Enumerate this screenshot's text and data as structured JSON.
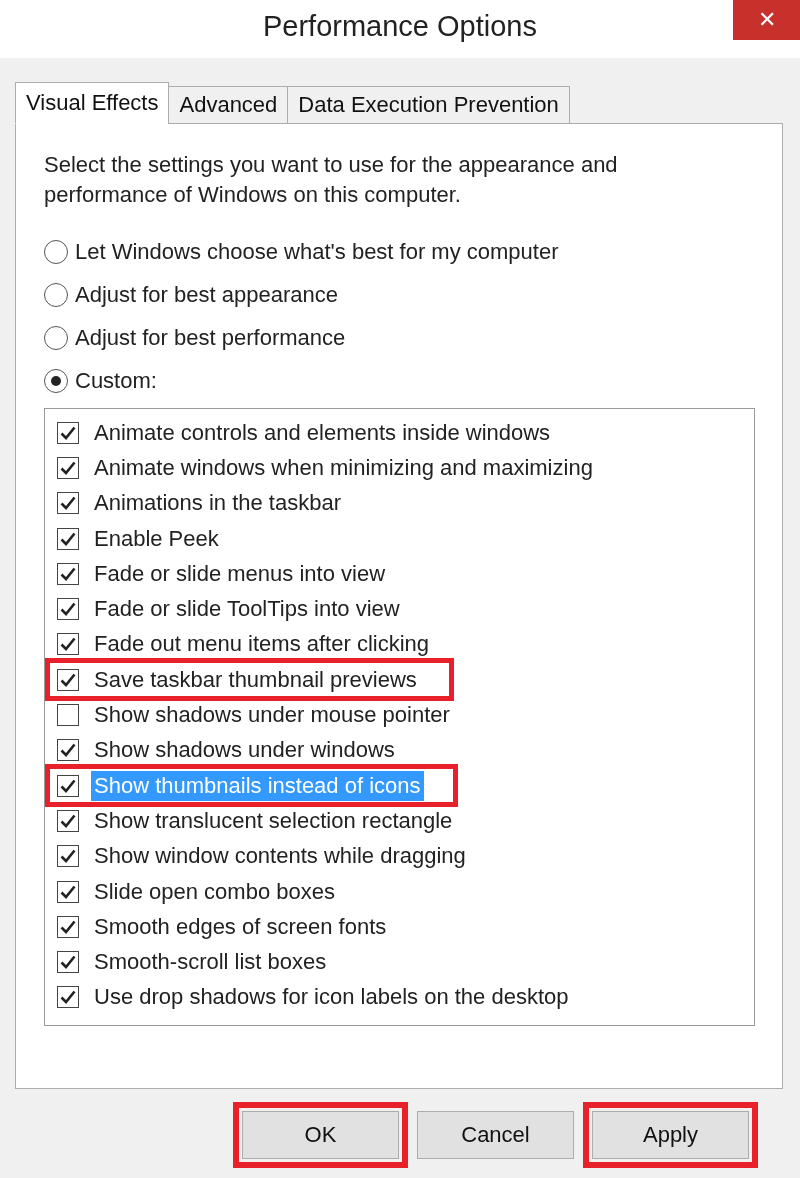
{
  "window": {
    "title": "Performance Options",
    "close": "✕"
  },
  "tabs": [
    {
      "label": "Visual Effects",
      "selected": true
    },
    {
      "label": "Advanced",
      "selected": false
    },
    {
      "label": "Data Execution Prevention",
      "selected": false
    }
  ],
  "description": "Select the settings you want to use for the appearance and performance of Windows on this computer.",
  "options": [
    {
      "label": "Let Windows choose what's best for my computer",
      "selected": false
    },
    {
      "label": "Adjust for best appearance",
      "selected": false
    },
    {
      "label": "Adjust for best performance",
      "selected": false
    },
    {
      "label": "Custom:",
      "selected": true
    }
  ],
  "effects": [
    {
      "label": "Animate controls and elements inside windows",
      "checked": true,
      "selected": false,
      "annotated": false
    },
    {
      "label": "Animate windows when minimizing and maximizing",
      "checked": true,
      "selected": false,
      "annotated": false
    },
    {
      "label": "Animations in the taskbar",
      "checked": true,
      "selected": false,
      "annotated": false
    },
    {
      "label": "Enable Peek",
      "checked": true,
      "selected": false,
      "annotated": false
    },
    {
      "label": "Fade or slide menus into view",
      "checked": true,
      "selected": false,
      "annotated": false
    },
    {
      "label": "Fade or slide ToolTips into view",
      "checked": true,
      "selected": false,
      "annotated": false
    },
    {
      "label": "Fade out menu items after clicking",
      "checked": true,
      "selected": false,
      "annotated": false
    },
    {
      "label": "Save taskbar thumbnail previews",
      "checked": true,
      "selected": false,
      "annotated": true
    },
    {
      "label": "Show shadows under mouse pointer",
      "checked": false,
      "selected": false,
      "annotated": false
    },
    {
      "label": "Show shadows under windows",
      "checked": true,
      "selected": false,
      "annotated": false
    },
    {
      "label": "Show thumbnails instead of icons",
      "checked": true,
      "selected": true,
      "annotated": true
    },
    {
      "label": "Show translucent selection rectangle",
      "checked": true,
      "selected": false,
      "annotated": false
    },
    {
      "label": "Show window contents while dragging",
      "checked": true,
      "selected": false,
      "annotated": false
    },
    {
      "label": "Slide open combo boxes",
      "checked": true,
      "selected": false,
      "annotated": false
    },
    {
      "label": "Smooth edges of screen fonts",
      "checked": true,
      "selected": false,
      "annotated": false
    },
    {
      "label": "Smooth-scroll list boxes",
      "checked": true,
      "selected": false,
      "annotated": false
    },
    {
      "label": "Use drop shadows for icon labels on the desktop",
      "checked": true,
      "selected": false,
      "annotated": false
    }
  ],
  "buttons": [
    {
      "label": "OK",
      "annotated": true
    },
    {
      "label": "Cancel",
      "annotated": false
    },
    {
      "label": "Apply",
      "annotated": true
    }
  ]
}
